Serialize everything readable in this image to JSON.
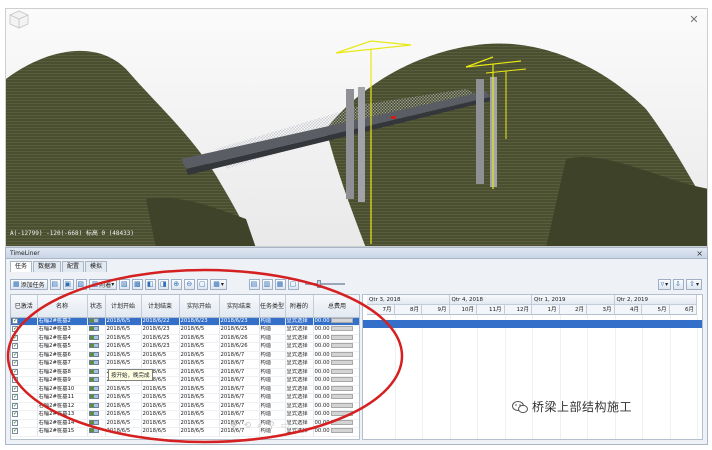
{
  "viewport": {
    "coord_readout": "A(-12799) -120(-668) 标高 0 (48433)",
    "close_glyph": "✕",
    "colors": {
      "terrain": "#4e5234",
      "sky": "#f4f4f4",
      "crane": "#e8e814",
      "deck": "#56595e",
      "pier": "#8d8f94"
    }
  },
  "timeliner": {
    "title": "TimeLiner",
    "close_glyph": "×",
    "tabs": [
      "任务",
      "数据源",
      "配置",
      "模拟"
    ],
    "toolbar": {
      "add_task": "添加任务",
      "attach": "附着",
      "icons": [
        "insert-task-icon",
        "delete-task-icon",
        "auto-add-icon",
        "link-icon",
        "outdent-icon",
        "indent-icon",
        "zoom-in-icon",
        "zoom-out-icon",
        "filter-icon",
        "export-icon"
      ]
    },
    "columns": [
      "已激活",
      "名称",
      "状态",
      "计划开始",
      "计划结束",
      "实际开始",
      "实际结束",
      "任务类型",
      "附着的",
      "总费用"
    ],
    "rows": [
      {
        "name": "右幅2#桩基2",
        "plan_start": "2018/6/5",
        "plan_end": "2018/6/22",
        "act_start": "2018/6/23",
        "act_end": "2018/6/23",
        "type": "构造",
        "attached": "显式选择",
        "cost": "00.00",
        "selected": true
      },
      {
        "name": "右幅2#桩基3",
        "plan_start": "2018/6/5",
        "plan_end": "2018/6/23",
        "act_start": "2018/6/5",
        "act_end": "2018/6/25",
        "type": "构造",
        "attached": "显式选择",
        "cost": "00.00"
      },
      {
        "name": "右幅2#桩基4",
        "plan_start": "2018/6/5",
        "plan_end": "2018/6/25",
        "act_start": "2018/6/5",
        "act_end": "2018/6/26",
        "type": "构造",
        "attached": "显式选择",
        "cost": "00.00"
      },
      {
        "name": "右幅2#桩基5",
        "plan_start": "2018/6/5",
        "plan_end": "2018/6/23",
        "act_start": "2018/6/5",
        "act_end": "2018/6/26",
        "type": "构造",
        "attached": "显式选择",
        "cost": "00.00"
      },
      {
        "name": "右幅2#桩基6",
        "plan_start": "2018/6/5",
        "plan_end": "2018/6/5",
        "act_start": "2018/6/5",
        "act_end": "2018/6/7",
        "type": "构造",
        "attached": "显式选择",
        "cost": "00.00"
      },
      {
        "name": "右幅2#桩基7",
        "plan_start": "2018/6/5",
        "plan_end": "2018/6/5",
        "act_start": "2018/6/5",
        "act_end": "2018/6/7",
        "type": "构造",
        "attached": "显式选择",
        "cost": "00.00"
      },
      {
        "name": "右幅2#桩基8",
        "plan_start": "2018/6/5",
        "plan_end": "2018/6/5",
        "act_start": "2018/6/5",
        "act_end": "2018/6/7",
        "type": "构造",
        "attached": "显式选择",
        "cost": "00.00"
      },
      {
        "name": "右幅2#桩基9",
        "plan_start": "2018/6/5",
        "plan_end": "2018/6/5",
        "act_start": "2018/6/5",
        "act_end": "2018/6/7",
        "type": "构造",
        "attached": "显式选择",
        "cost": "00.00"
      },
      {
        "name": "右幅2#桩基10",
        "plan_start": "2018/6/5",
        "plan_end": "2018/6/5",
        "act_start": "2018/6/5",
        "act_end": "2018/6/7",
        "type": "构造",
        "attached": "显式选择",
        "cost": "00.00"
      },
      {
        "name": "右幅2#桩基11",
        "plan_start": "2018/6/5",
        "plan_end": "2018/6/5",
        "act_start": "2018/6/5",
        "act_end": "2018/6/7",
        "type": "构造",
        "attached": "显式选择",
        "cost": "00.00"
      },
      {
        "name": "右幅2#桩基12",
        "plan_start": "2018/6/5",
        "plan_end": "2018/6/5",
        "act_start": "2018/6/5",
        "act_end": "2018/6/7",
        "type": "构造",
        "attached": "显式选择",
        "cost": "00.00"
      },
      {
        "name": "右幅2#桩基13",
        "plan_start": "2018/6/5",
        "plan_end": "2018/6/5",
        "act_start": "2018/6/5",
        "act_end": "2018/6/7",
        "type": "构造",
        "attached": "显式选择",
        "cost": "00.00"
      },
      {
        "name": "右幅2#桩基14",
        "plan_start": "2018/6/5",
        "plan_end": "2018/6/5",
        "act_start": "2018/6/5",
        "act_end": "2018/6/7",
        "type": "构造",
        "attached": "显式选择",
        "cost": "00.00"
      },
      {
        "name": "右幅2#桩基15",
        "plan_start": "2018/6/5",
        "plan_end": "2018/6/5",
        "act_start": "2018/6/5",
        "act_end": "2018/6/7",
        "type": "构造",
        "attached": "显式选择",
        "cost": "00.00"
      }
    ],
    "tooltip": "按开始，晚完成",
    "gantt": {
      "quarters": [
        "Qtr 3, 2018",
        "Qtr 4, 2018",
        "Qtr 1, 2019",
        "Qtr 2, 2019"
      ],
      "months": [
        "7月",
        "8月",
        "9月",
        "10月",
        "11月",
        "12月",
        "1月",
        "2月",
        "3月",
        "4月",
        "5月",
        "6月"
      ]
    }
  },
  "watermark": {
    "text": "桥梁上部结构施工"
  },
  "annotation_color": "#d42020"
}
